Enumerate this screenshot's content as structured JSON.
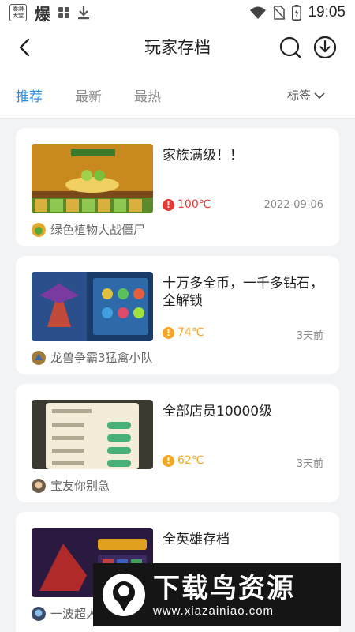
{
  "status_bar": {
    "badge_text": "澎湃大宝",
    "bao_text": "爆",
    "time": "19:05"
  },
  "header": {
    "title": "玩家存档"
  },
  "tabs": {
    "items": [
      "推荐",
      "最新",
      "最热"
    ],
    "active_index": 0,
    "tag_label": "标签"
  },
  "posts": [
    {
      "title": "家族满级！！",
      "heat": "100℃",
      "heat_color": "#e53935",
      "date": "2022-09-06",
      "game": "绿色植物大战僵尸"
    },
    {
      "title": "十万多全币，一千多钻石，全解锁",
      "heat": "74℃",
      "heat_color": "#f5a623",
      "date": "3天前",
      "game": "龙兽争霸3猛禽小队"
    },
    {
      "title": "全部店员10000级",
      "heat": "62℃",
      "heat_color": "#f5a623",
      "date": "3天前",
      "game": "宝友你别急"
    },
    {
      "title": "全英雄存档",
      "heat": "",
      "heat_color": "#f5a623",
      "date": "",
      "game": "一波超人"
    }
  ],
  "watermark": {
    "title": "下载鸟资源",
    "url": "www.xiazainiao.com"
  },
  "colors": {
    "accent": "#2f8be6",
    "hot": "#e53935",
    "warm": "#f5a623"
  }
}
